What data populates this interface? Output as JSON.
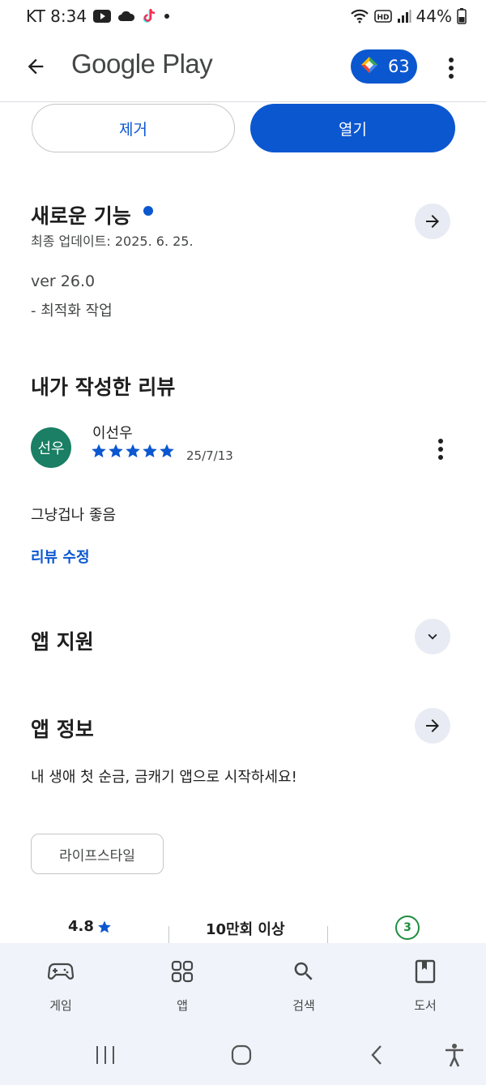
{
  "status_bar": {
    "carrier_time": "KT 8:34",
    "battery": "44%",
    "icons": [
      "youtube-icon",
      "cloud-icon",
      "tiktok-icon",
      "dot-icon",
      "wifi-icon",
      "hd-icon",
      "signal-icon",
      "battery-icon"
    ]
  },
  "app_bar": {
    "title": "Google Play",
    "points": "63",
    "accent": "#0b57d0"
  },
  "actions": {
    "remove_label": "제거",
    "open_label": "열기"
  },
  "whats_new": {
    "title": "새로운 기능",
    "updated": "최종 업데이트: 2025. 6. 25.",
    "version": "ver 26.0",
    "note": "- 최적화 작업"
  },
  "my_review": {
    "title": "내가 작성한 리뷰",
    "avatar_text": "선우",
    "avatar_color": "#1a7f64",
    "reviewer": "이선우",
    "rating": 5,
    "date": "25/7/13",
    "text": "그냥겁나 좋음",
    "edit_label": "리뷰 수정"
  },
  "app_support": {
    "title": "앱 지원"
  },
  "about_app": {
    "title": "앱 정보",
    "description": "내 생애 첫 순금, 금캐기 앱으로 시작하세요!",
    "tag": "라이프스타일"
  },
  "stats": {
    "rating": "4.8",
    "downloads": "10만회 이상",
    "content_rating": "3"
  },
  "bottom_nav": [
    {
      "label": "게임",
      "icon": "gamepad-icon"
    },
    {
      "label": "앱",
      "icon": "apps-grid-icon"
    },
    {
      "label": "검색",
      "icon": "search-icon"
    },
    {
      "label": "도서",
      "icon": "book-icon"
    }
  ]
}
